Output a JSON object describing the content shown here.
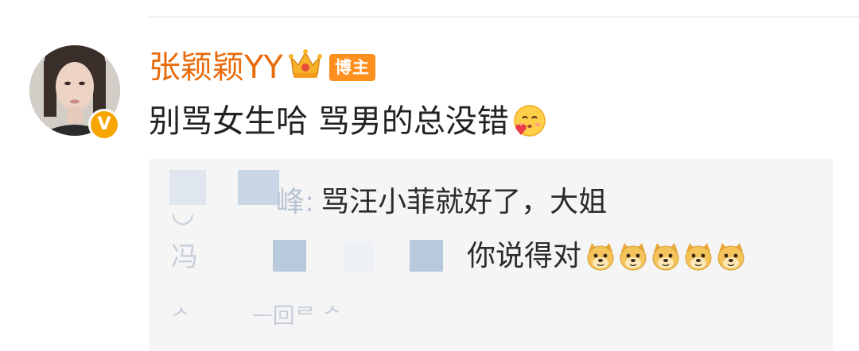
{
  "post": {
    "username": "张颖颖YY",
    "badge_label": "博主",
    "verified_icon": "V",
    "content_text": "别骂女生哈 骂男的总没错",
    "content_emoji": "cute-face-emoji"
  },
  "replies": [
    {
      "visible_tail": "峰:",
      "text": "骂汪小菲就好了，大姐"
    },
    {
      "text": "你说得对",
      "emoji": "doge-emoji",
      "emoji_count": 5
    }
  ],
  "colors": {
    "username": "#e86b0c",
    "badge": "#ff8f1f",
    "verified": "#f7a600",
    "reply_bg": "#f5f5f5",
    "blur": "#c9d6e5"
  }
}
